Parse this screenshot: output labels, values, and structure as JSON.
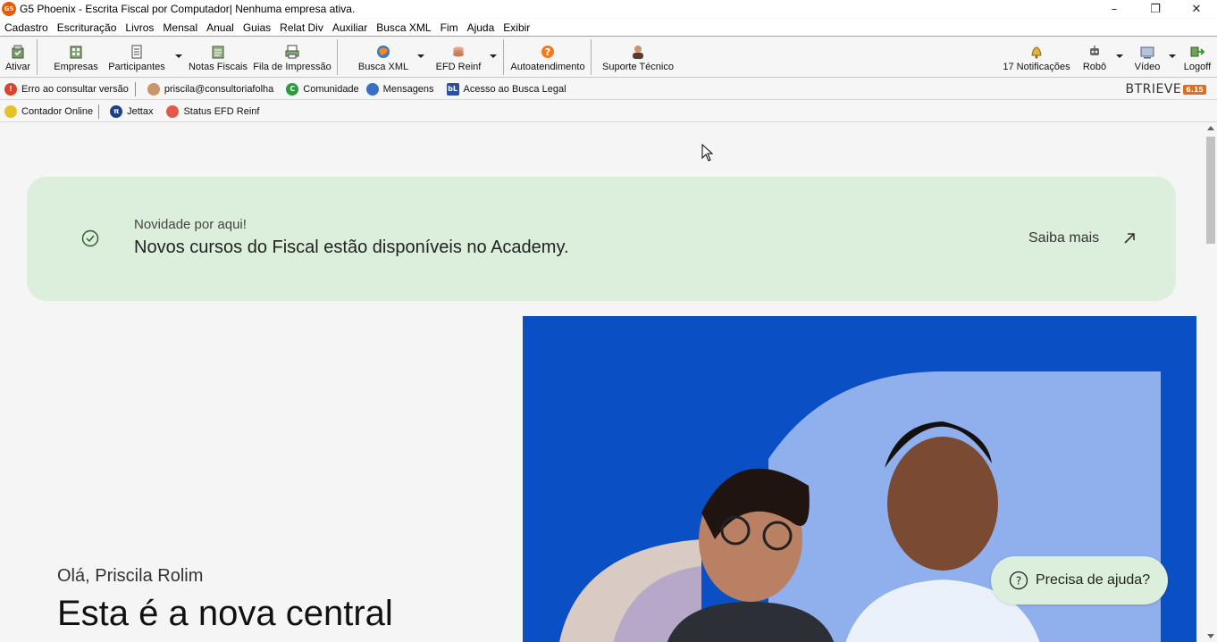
{
  "window": {
    "logo_text": "G5",
    "title": "G5 Phoenix - Escrita Fiscal por Computador| Nenhuma empresa ativa.",
    "controls": {
      "minimize": "–",
      "maximize": "❐",
      "close": "✕"
    }
  },
  "menu": {
    "items": [
      "Cadastro",
      "Escrituração",
      "Livros",
      "Mensal",
      "Anual",
      "Guias",
      "Relat Div",
      "Auxiliar",
      "Busca XML",
      "Fim",
      "Ajuda",
      "Exibir"
    ]
  },
  "toolbar": {
    "ativar": "Ativar",
    "empresas": "Empresas",
    "participantes": "Participantes",
    "notas_fiscais": "Notas Fiscais",
    "fila_impressao": "Fila de Impressão",
    "busca_xml": "Busca XML",
    "efd_reinf": "EFD Reinf",
    "autoatendimento": "Autoatendimento",
    "suporte_tecnico": "Suporte Técnico",
    "notificacoes": "17 Notificações",
    "robo": "Robô",
    "video": "Vídeo",
    "logoff": "Logoff"
  },
  "links_row1": {
    "erro_versao": "Erro ao consultar versão",
    "usuario": "priscila@consultoriafolha",
    "comunidade": "Comunidade",
    "mensagens": "Mensagens",
    "busca_legal": "Acesso ao Busca Legal",
    "btrieve": "BTRIEVE",
    "btrieve_version": "6.15"
  },
  "links_row2": {
    "contador_online": "Contador Online",
    "jettax": "Jettax",
    "status_reinf": "Status EFD Reinf"
  },
  "banner": {
    "kicker": "Novidade por aqui!",
    "title": "Novos cursos do Fiscal estão disponíveis no Academy.",
    "link": "Saiba mais"
  },
  "hero": {
    "greeting": "Olá, Priscila Rolim",
    "headline": "Esta é a nova central"
  },
  "help": {
    "label": "Precisa de ajuda?"
  },
  "colors": {
    "banner_bg": "#dcefdc",
    "hero_blue": "#0a4fc4",
    "accent_orange": "#e8590c"
  }
}
